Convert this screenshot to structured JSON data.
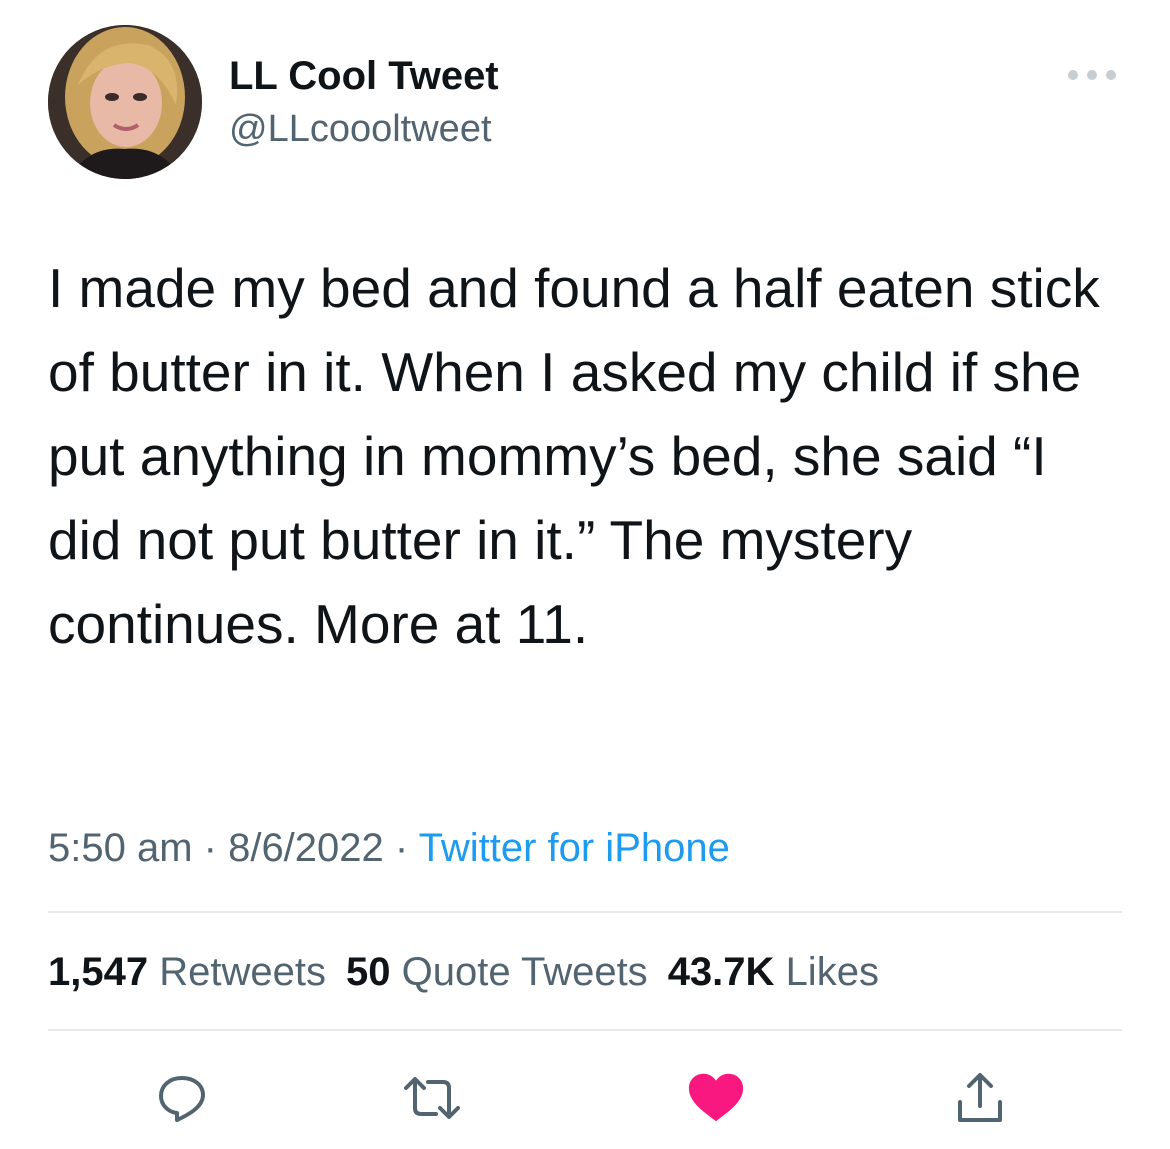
{
  "author": {
    "name": "LL Cool Tweet",
    "handle": "@LLcoooltweet"
  },
  "tweet": {
    "text": "I made my bed and found a half eaten stick of butter in it. When I asked my child if she put anything in mommy’s bed, she said “I did not put butter in it.” The mystery continues. More at 11.",
    "time": "5:50 am",
    "date": "8/6/2022",
    "source": "Twitter for iPhone",
    "separator": " · "
  },
  "stats": {
    "retweets_count": "1,547",
    "retweets_label": "Retweets",
    "quotes_count": "50",
    "quotes_label": "Quote Tweets",
    "likes_count": "43.7K",
    "likes_label": "Likes"
  },
  "icons": {
    "more": "more-dots-icon",
    "reply": "reply-icon",
    "retweet": "retweet-icon",
    "like": "heart-icon",
    "share": "share-icon"
  },
  "colors": {
    "link": "#1d9bf0",
    "muted": "#536471",
    "like": "#f91880",
    "divider": "#e6e9eb"
  }
}
